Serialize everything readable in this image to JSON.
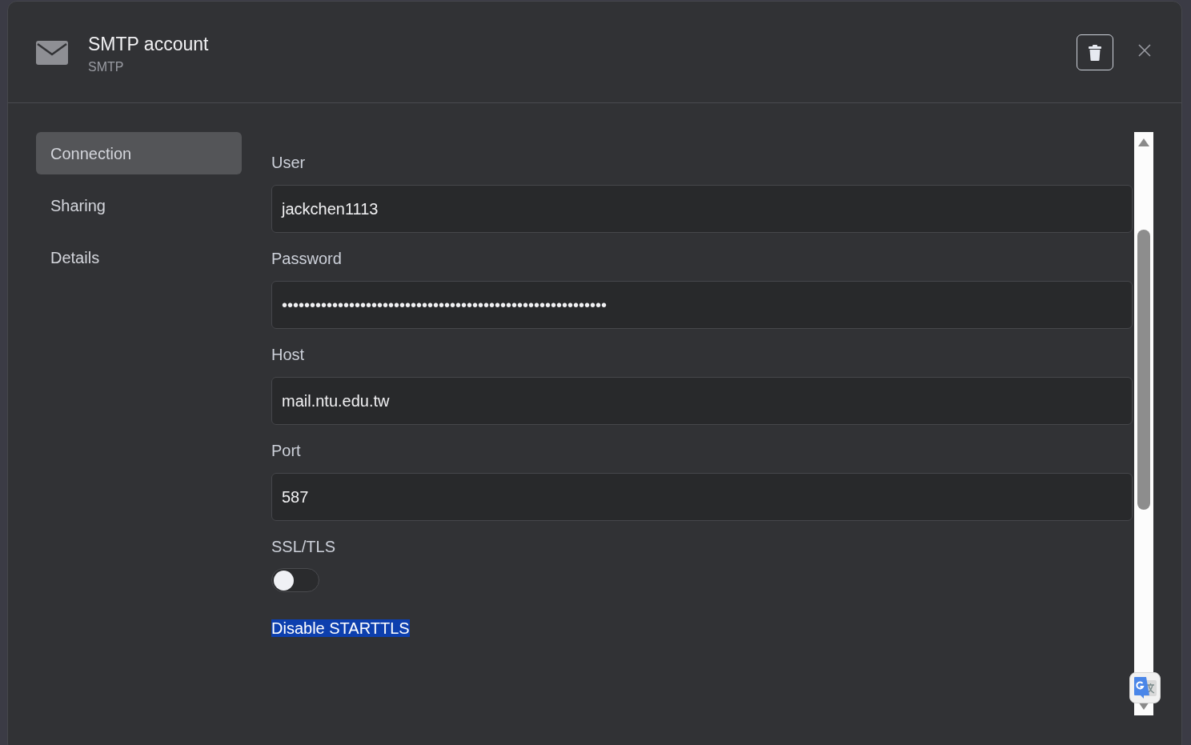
{
  "dialog": {
    "title": "SMTP account",
    "subtitle": "SMTP"
  },
  "nav": [
    {
      "label": "Connection",
      "selected": true
    },
    {
      "label": "Sharing",
      "selected": false
    },
    {
      "label": "Details",
      "selected": false
    }
  ],
  "fields": [
    {
      "kind": "text",
      "label": "User",
      "value": "jackchen1113"
    },
    {
      "kind": "text",
      "label": "Password",
      "value": "••••••••••••••••••••••••••••••••••••••••••••••••••••••••••"
    },
    {
      "kind": "text",
      "label": "Host",
      "value": "mail.ntu.edu.tw"
    },
    {
      "kind": "text",
      "label": "Port",
      "value": "587"
    },
    {
      "kind": "toggle",
      "label": "SSL/TLS",
      "on": false
    },
    {
      "kind": "selected-label",
      "label": "Disable STARTTLS"
    }
  ]
}
